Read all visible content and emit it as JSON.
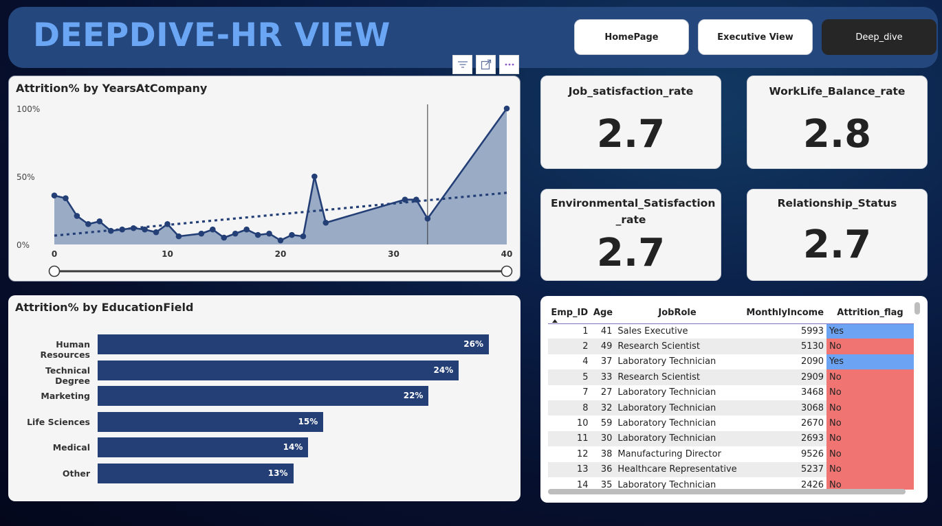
{
  "header": {
    "title": "DEEPDIVE-HR VIEW",
    "nav": [
      {
        "label": "HomePage",
        "active": false
      },
      {
        "label": "Executive View",
        "active": false
      },
      {
        "label": "Deep_dive",
        "active": true
      }
    ]
  },
  "visual_toolbar": [
    "filter-icon",
    "focus-mode-icon",
    "more-options-icon"
  ],
  "line_chart": {
    "title": "Attrition% by YearsAtCompany",
    "chart_data": {
      "type": "area",
      "x": [
        0,
        1,
        2,
        3,
        4,
        5,
        6,
        7,
        8,
        9,
        10,
        11,
        13,
        14,
        15,
        16,
        17,
        18,
        19,
        20,
        21,
        22,
        23,
        24,
        31,
        32,
        33,
        40
      ],
      "values": [
        36,
        34,
        21,
        15,
        17,
        10,
        11,
        12,
        11,
        9,
        15,
        6,
        8,
        11,
        5,
        8,
        11,
        7,
        8,
        3,
        7,
        6,
        50,
        16,
        33,
        33,
        19,
        100
      ],
      "trend": [
        6.5,
        38
      ],
      "ylim": [
        0,
        100
      ],
      "xlim": [
        0,
        40
      ],
      "y_ticks": [
        "100%",
        "50%",
        "0%"
      ],
      "x_ticks": [
        "0",
        "10",
        "20",
        "30",
        "40"
      ],
      "reference_x": 33,
      "colors": {
        "fill": "#9aabc6",
        "line": "#233f76",
        "trend": "#233f76"
      }
    }
  },
  "kpis": [
    {
      "label": "Job_satisfaction_rate",
      "value": "2.7"
    },
    {
      "label": "WorkLife_Balance_rate",
      "value": "2.8"
    },
    {
      "label": "Environmental_Satisfaction _rate",
      "value": "2.7"
    },
    {
      "label": "Relationship_Status",
      "value": "2.7"
    }
  ],
  "bar_chart": {
    "title": "Attrition% by EducationField",
    "chart_data": {
      "type": "bar",
      "categories": [
        "Human Resources",
        "Technical Degree",
        "Marketing",
        "Life Sciences",
        "Medical",
        "Other"
      ],
      "values": [
        26,
        24,
        22,
        15,
        14,
        13
      ],
      "labels": [
        "26%",
        "24%",
        "22%",
        "15%",
        "14%",
        "13%"
      ],
      "xlim": [
        0,
        26
      ],
      "color": "#233f76"
    }
  },
  "table": {
    "columns": [
      "Emp_ID",
      "Age",
      "JobRole",
      "MonthlyIncome",
      "Attrition_flag"
    ],
    "rows": [
      [
        "1",
        "41",
        "Sales Executive",
        "5993",
        "Yes"
      ],
      [
        "2",
        "49",
        "Research Scientist",
        "5130",
        "No"
      ],
      [
        "4",
        "37",
        "Laboratory Technician",
        "2090",
        "Yes"
      ],
      [
        "5",
        "33",
        "Research Scientist",
        "2909",
        "No"
      ],
      [
        "7",
        "27",
        "Laboratory Technician",
        "3468",
        "No"
      ],
      [
        "8",
        "32",
        "Laboratory Technician",
        "3068",
        "No"
      ],
      [
        "10",
        "59",
        "Laboratory Technician",
        "2670",
        "No"
      ],
      [
        "11",
        "30",
        "Laboratory Technician",
        "2693",
        "No"
      ],
      [
        "12",
        "38",
        "Manufacturing Director",
        "9526",
        "No"
      ],
      [
        "13",
        "36",
        "Healthcare Representative",
        "5237",
        "No"
      ],
      [
        "14",
        "35",
        "Laboratory Technician",
        "2426",
        "No"
      ]
    ],
    "colors": {
      "yes": "#6ca3f2",
      "no": "#ef7472"
    }
  }
}
